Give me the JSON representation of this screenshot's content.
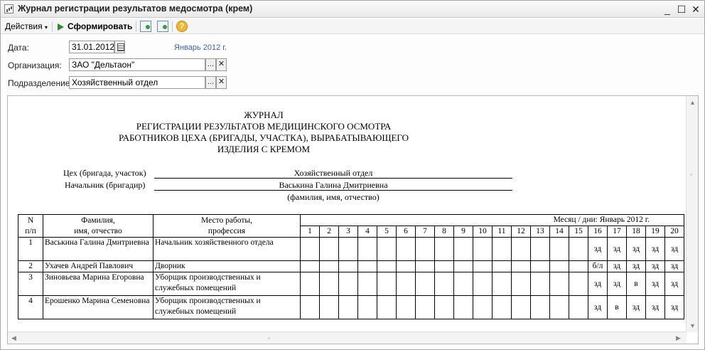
{
  "window": {
    "title": "Журнал регистрации результатов медосмотра (крем)",
    "controls": [
      "_",
      "☐",
      "✕"
    ]
  },
  "toolbar": {
    "actions_label": "Действия",
    "generate_label": "Сформировать",
    "help_glyph": "?"
  },
  "form": {
    "date_label": "Дата:",
    "date_value": "31.01.2012",
    "month_hint": "Январь 2012 г.",
    "org_label": "Организация:",
    "org_value": "ЗАО \"Дельтаон\"",
    "dept_label": "Подразделение:",
    "dept_value": "Хозяйственный отдел",
    "select_glyph": "...",
    "clear_glyph": "✕"
  },
  "report": {
    "title_lines": [
      "ЖУРНАЛ",
      "РЕГИСТРАЦИИ РЕЗУЛЬТАТОВ МЕДИЦИНСКОГО ОСМОТРА",
      "РАБОТНИКОВ ЦЕХА (БРИГАДЫ, УЧАСТКА), ВЫРАБАТЫВАЮЩЕГО",
      "ИЗДЕЛИЯ С КРЕМОМ"
    ],
    "shop_label": "Цех (бригада, участок)",
    "shop_value": "Хозяйственный отдел",
    "chief_label": "Начальник (бригадир)",
    "chief_value": "Васькина Галина Дмитриевна",
    "chief_hint": "(фамилия, имя, отчество)",
    "columns": {
      "num_line1": "N",
      "num_line2": "п/п",
      "name_line1": "Фамилия,",
      "name_line2": "имя, отчество",
      "place_line1": "Место работы,",
      "place_line2": "профессия",
      "month": "Месяц / дни: Январь 2012 г.",
      "days": [
        "1",
        "2",
        "3",
        "4",
        "5",
        "6",
        "7",
        "8",
        "9",
        "10",
        "11",
        "12",
        "13",
        "14",
        "15",
        "16",
        "17",
        "18",
        "19",
        "20"
      ]
    },
    "rows": [
      {
        "n": "1",
        "name": "Васькина Галина Дмитриевна",
        "place": "Начальник хозяйственного отдела",
        "marks": [
          "",
          "",
          "",
          "",
          "",
          "",
          "",
          "",
          "",
          "",
          "",
          "",
          "",
          "",
          "",
          "зд",
          "зд",
          "зд",
          "зд",
          "зд"
        ]
      },
      {
        "n": "2",
        "name": "Ухачев Андрей Павлович",
        "place": "Дворник",
        "marks": [
          "",
          "",
          "",
          "",
          "",
          "",
          "",
          "",
          "",
          "",
          "",
          "",
          "",
          "",
          "",
          "б/л",
          "зд",
          "зд",
          "зд",
          "зд"
        ]
      },
      {
        "n": "3",
        "name": "Зиновьева Марина Егоровна",
        "place": "Уборщик производственных и служебных помещений",
        "marks": [
          "",
          "",
          "",
          "",
          "",
          "",
          "",
          "",
          "",
          "",
          "",
          "",
          "",
          "",
          "",
          "зд",
          "зд",
          "в",
          "зд",
          "зд"
        ]
      },
      {
        "n": "4",
        "name": "Ерошенко Марина Семеновна",
        "place": "Уборщик производственных и служебных помещений",
        "marks": [
          "",
          "",
          "",
          "",
          "",
          "",
          "",
          "",
          "",
          "",
          "",
          "",
          "",
          "",
          "",
          "зд",
          "в",
          "зд",
          "зд",
          "зд"
        ]
      }
    ]
  }
}
